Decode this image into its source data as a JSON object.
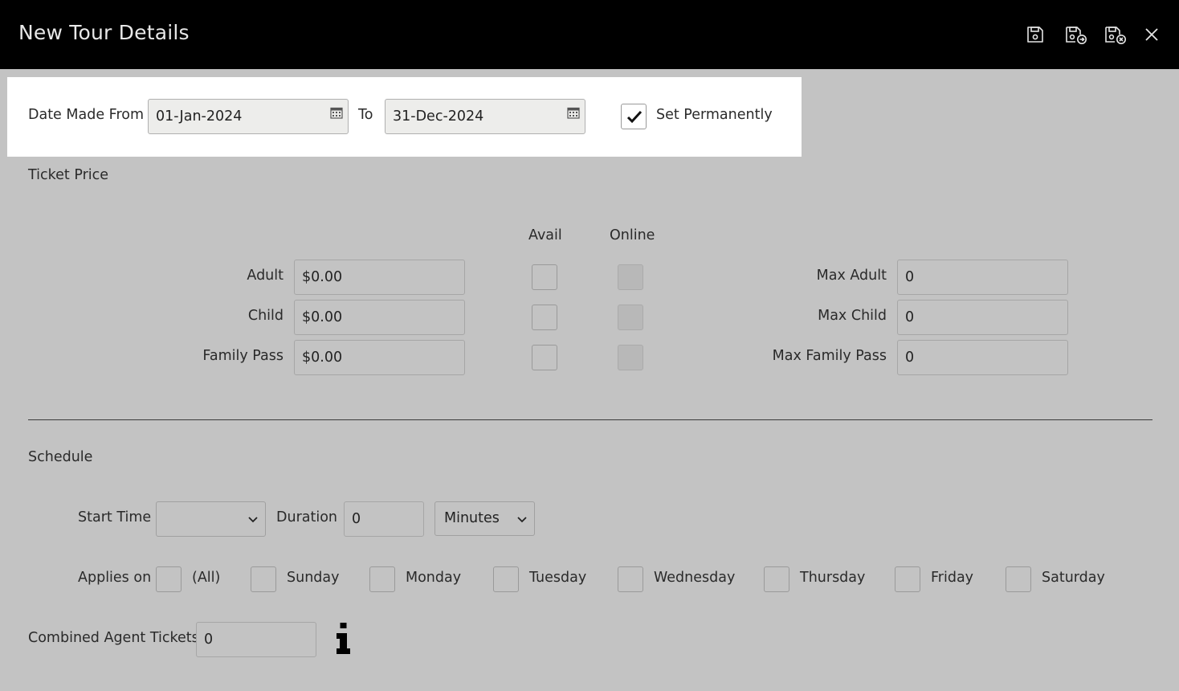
{
  "window": {
    "title": "New Tour Details",
    "icons": [
      "save-icon",
      "save-and-new-icon",
      "save-and-close-icon",
      "close-icon"
    ]
  },
  "date_range": {
    "from_label": "Date Made From",
    "from_value": "01-Jan-2024",
    "to_label": "To",
    "to_value": "31-Dec-2024",
    "set_permanently_label": "Set Permanently",
    "set_permanently_checked": true
  },
  "ticket_price": {
    "section_label": "Ticket Price",
    "avail_header": "Avail",
    "online_header": "Online",
    "rows": [
      {
        "label": "Adult",
        "price": "$0.00",
        "max_label": "Max Adult",
        "max_value": "0"
      },
      {
        "label": "Child",
        "price": "$0.00",
        "max_label": "Max Child",
        "max_value": "0"
      },
      {
        "label": "Family Pass",
        "price": "$0.00",
        "max_label": "Max Family Pass",
        "max_value": "0"
      }
    ]
  },
  "schedule": {
    "section_label": "Schedule",
    "start_time_label": "Start Time",
    "start_time_value": "",
    "duration_label": "Duration",
    "duration_value": "0",
    "duration_unit": "Minutes",
    "applies_on_label": "Applies on",
    "days": [
      "(All)",
      "Sunday",
      "Monday",
      "Tuesday",
      "Wednesday",
      "Thursday",
      "Friday",
      "Saturday"
    ],
    "combined_agent_label": "Combined Agent Tickets",
    "combined_agent_value": "0"
  },
  "colors": {
    "titlebar": "#000000",
    "background": "#c3c3c3",
    "highlight": "#ffffff"
  }
}
